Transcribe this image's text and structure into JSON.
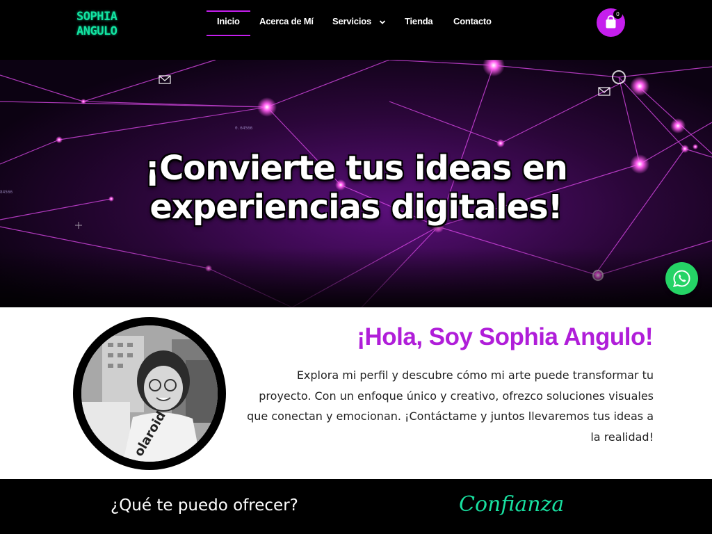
{
  "header": {
    "logo_line1": "SOPHIA",
    "logo_line2": "ANGULO",
    "nav": {
      "inicio": "Inicio",
      "acerca": "Acerca de Mí",
      "servicios": "Servicios",
      "tienda": "Tienda",
      "contacto": "Contacto"
    },
    "cart_count": "0"
  },
  "hero": {
    "title_line1": "¡Convierte tus ideas en",
    "title_line2": "experiencias digitales!"
  },
  "about": {
    "title": "¡Hola, Soy Sophia Angulo!",
    "text": "Explora mi perfil y descubre cómo mi arte puede transformar tu proyecto. Con un enfoque único y creativo, ofrezco soluciones visuales que conectan y emocionan. ¡Contáctame y juntos llevaremos tus ideas a la realidad!"
  },
  "band": {
    "offer": "¿Qué te puedo ofrecer?",
    "trust": "Confianza"
  },
  "colors": {
    "accent": "#c51eed",
    "title_purple": "#b01ed9",
    "logo_green": "#12e5a2",
    "whatsapp": "#25d366"
  },
  "icons": [
    "shopping-bag-icon",
    "chevron-down-icon",
    "whatsapp-icon",
    "email-icon"
  ]
}
